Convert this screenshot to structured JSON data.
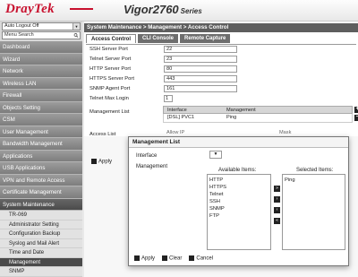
{
  "brand": {
    "logo": "DrayTek",
    "model": "Vigor2760",
    "series": "Series",
    "accent": "#c8102e"
  },
  "sidebar": {
    "logout_value": "Auto Logout Off",
    "search_placeholder": "Menu Search",
    "items": [
      {
        "label": "Dashboard"
      },
      {
        "label": "Wizard"
      },
      {
        "label": "Network"
      },
      {
        "label": "Wireless LAN"
      },
      {
        "label": "Firewall"
      },
      {
        "label": "Objects Setting"
      },
      {
        "label": "CSM"
      },
      {
        "label": "User Management"
      },
      {
        "label": "Bandwidth Management"
      },
      {
        "label": "Applications"
      },
      {
        "label": "USB Applications"
      },
      {
        "label": "VPN and Remote Access"
      },
      {
        "label": "Certificate Management"
      },
      {
        "label": "System Maintenance"
      }
    ],
    "subitems": [
      {
        "label": "TR-069"
      },
      {
        "label": "Administrator Setting"
      },
      {
        "label": "Configuration Backup"
      },
      {
        "label": "Syslog and Mail Alert"
      },
      {
        "label": "Time and Date"
      },
      {
        "label": "Management"
      },
      {
        "label": "SNMP"
      }
    ]
  },
  "main": {
    "breadcrumb": "System Maintenance > Management > Access Control",
    "tabs": [
      {
        "label": "Access Control"
      },
      {
        "label": "CLI Console"
      },
      {
        "label": "Remote Capture"
      }
    ],
    "fields": [
      {
        "label": "SSH Server Port",
        "value": "22"
      },
      {
        "label": "Telnet Server Port",
        "value": "23"
      },
      {
        "label": "HTTP Server Port",
        "value": "80"
      },
      {
        "label": "HTTPS Server Port",
        "value": "443"
      },
      {
        "label": "SNMP Agent Port",
        "value": "161"
      }
    ],
    "telnet_max_login": {
      "label": "Telnet Max Login",
      "value": "1"
    },
    "management_list": {
      "label": "Management List",
      "headers": [
        "Interface",
        "Management"
      ],
      "rows": [
        {
          "interface": "[DSL] PVC1",
          "management": "Ping"
        }
      ]
    },
    "access_list": {
      "label": "Access List",
      "col1": "Allow IP",
      "col2": "Mask"
    },
    "apply": "Apply"
  },
  "modal": {
    "title": "Management List",
    "interface_label": "Interface",
    "management_label": "Management",
    "available_label": "Available Items:",
    "selected_label": "Selected Items:",
    "available": [
      "HTTP",
      "HTTPS",
      "Telnet",
      "SSH",
      "SNMP",
      "FTP"
    ],
    "selected": [
      "Ping"
    ],
    "buttons": {
      "apply": "Apply",
      "clear": "Clear",
      "cancel": "Cancel"
    }
  }
}
